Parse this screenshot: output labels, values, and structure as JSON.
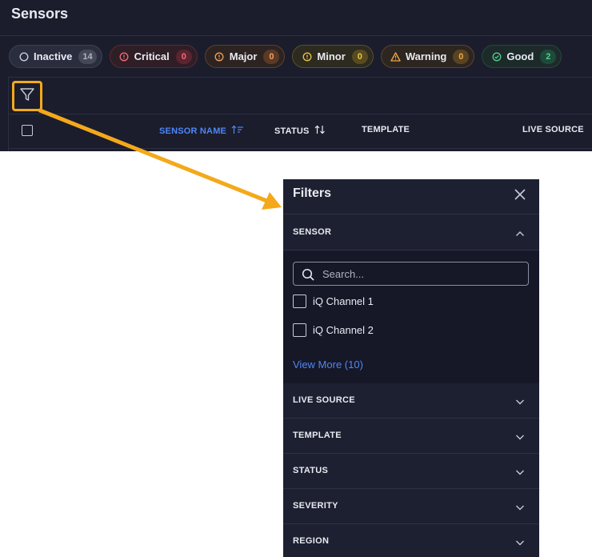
{
  "page": {
    "title": "Sensors"
  },
  "status_chips": [
    {
      "label": "Inactive",
      "count": "14"
    },
    {
      "label": "Critical",
      "count": "0"
    },
    {
      "label": "Major",
      "count": "0"
    },
    {
      "label": "Minor",
      "count": "0"
    },
    {
      "label": "Warning",
      "count": "0"
    },
    {
      "label": "Good",
      "count": "2"
    }
  ],
  "table": {
    "columns": [
      "SENSOR NAME",
      "STATUS",
      "TEMPLATE",
      "LIVE SOURCE"
    ]
  },
  "filters": {
    "title": "Filters",
    "sensor_section": {
      "label": "SENSOR",
      "search_placeholder": "Search...",
      "options": [
        "iQ Channel 1",
        "iQ Channel 2"
      ],
      "view_more": "View More (10)"
    },
    "collapsed_sections": [
      "LIVE SOURCE",
      "TEMPLATE",
      "STATUS",
      "SEVERITY",
      "REGION"
    ]
  },
  "colors": {
    "accent": "#4f86f7",
    "highlight": "#f4a91b",
    "critical": "#f06b75",
    "major": "#f0a060",
    "minor": "#e9c54a",
    "warning": "#f0a848",
    "good": "#4fd08e"
  },
  "icons": {
    "inactive": "circle-icon",
    "critical": "alert-circle-icon",
    "major": "alert-circle-icon",
    "minor": "alert-circle-icon",
    "warning": "warning-triangle-icon",
    "good": "check-circle-icon",
    "filter": "funnel-icon",
    "close": "close-icon",
    "search": "search-icon"
  }
}
